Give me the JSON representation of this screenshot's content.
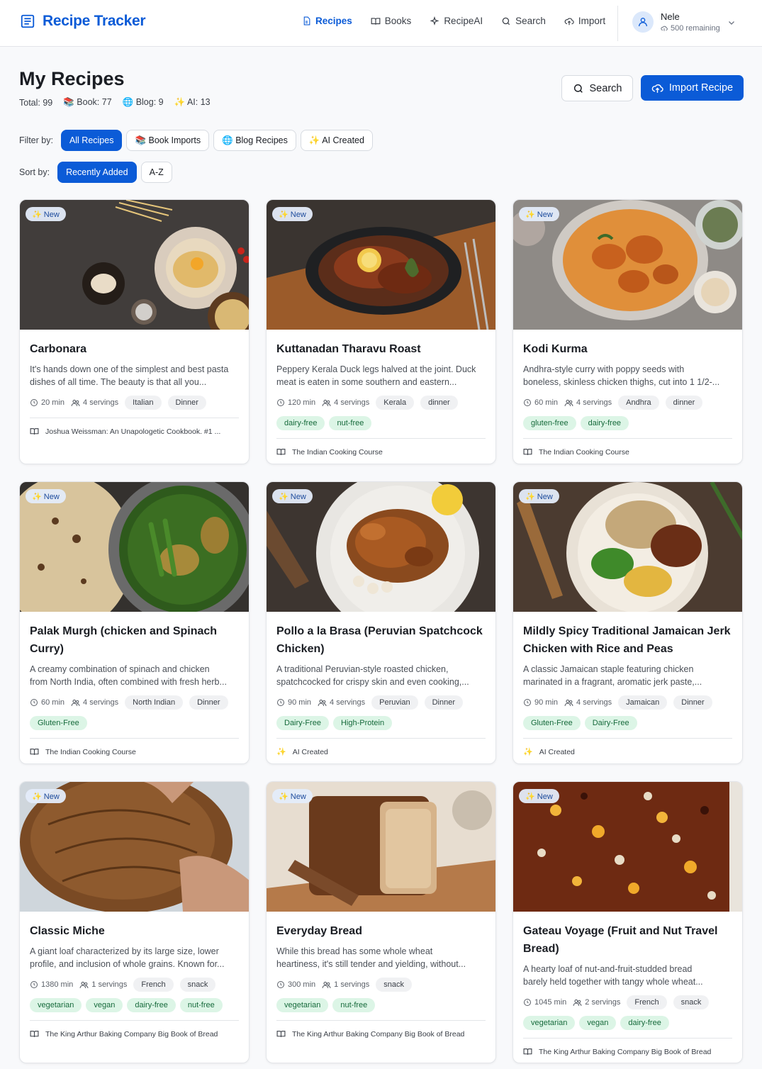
{
  "app": {
    "title": "Recipe Tracker"
  },
  "nav": [
    {
      "label": "Recipes",
      "icon": "document-icon",
      "active": true
    },
    {
      "label": "Books",
      "icon": "book-icon",
      "active": false
    },
    {
      "label": "RecipeAI",
      "icon": "sparkle-icon",
      "active": false
    },
    {
      "label": "Search",
      "icon": "search-icon",
      "active": false
    },
    {
      "label": "Import",
      "icon": "cloud-upload-icon",
      "active": false
    }
  ],
  "user": {
    "name": "Nele",
    "remaining": "500 remaining"
  },
  "page": {
    "title": "My Recipes",
    "totals": {
      "total": "Total: 99",
      "book": "📚 Book: 77",
      "blog": "🌐 Blog: 9",
      "ai": "✨ AI: 13"
    },
    "search_button": "Search",
    "import_button": "Import Recipe"
  },
  "filters": {
    "label": "Filter by:",
    "options": [
      "All Recipes",
      "📚 Book Imports",
      "🌐 Blog Recipes",
      "✨ AI Created"
    ],
    "selected": "All Recipes"
  },
  "sort": {
    "label": "Sort by:",
    "options": [
      "Recently Added",
      "A-Z"
    ],
    "selected": "Recently Added"
  },
  "badge_new": "✨ New",
  "colors": {
    "accent": "#0b5bd7",
    "tag_bg": "#dcf5e6",
    "tag_text": "#166a3b"
  },
  "recipes": [
    {
      "title": "Carbonara",
      "desc_1": "It's hands down one of the simplest and best pasta",
      "desc_2": "dishes of all time. The beauty is that all you...",
      "time": "20 min",
      "servings": "4 servings",
      "cuisine": "Italian",
      "course": "Dinner",
      "tags": [],
      "source": "Joshua Weissman: An Unapologetic Cookbook. #1 ...",
      "source_type": "book",
      "img": "pasta"
    },
    {
      "title": "Kuttanadan Tharavu Roast",
      "desc_1": "Peppery Kerala Duck legs halved at the joint. Duck",
      "desc_2": "meat is eaten in some southern and eastern...",
      "time": "120 min",
      "servings": "4 servings",
      "cuisine": "Kerala",
      "course": "dinner",
      "tags": [
        "dairy-free",
        "nut-free"
      ],
      "source": "The Indian Cooking Course",
      "source_type": "book",
      "img": "duck"
    },
    {
      "title": "Kodi Kurma",
      "desc_1": "Andhra-style curry with poppy seeds with",
      "desc_2": "boneless, skinless chicken thighs, cut into 1 1/2-...",
      "time": "60 min",
      "servings": "4 servings",
      "cuisine": "Andhra",
      "course": "dinner",
      "tags": [
        "gluten-free",
        "dairy-free"
      ],
      "source": "The Indian Cooking Course",
      "source_type": "book",
      "img": "kurma"
    },
    {
      "title": "Palak Murgh (chicken and Spinach Curry)",
      "desc_1": "A creamy combination of spinach and chicken",
      "desc_2": "from North India, often combined with fresh herb...",
      "time": "60 min",
      "servings": "4 servings",
      "cuisine": "North Indian",
      "course": "Dinner",
      "tags": [
        "Gluten-Free"
      ],
      "source": "The Indian Cooking Course",
      "source_type": "book",
      "img": "palak"
    },
    {
      "title": "Pollo a la Brasa (Peruvian Spatchcock Chicken)",
      "desc_1": "A traditional Peruvian-style roasted chicken,",
      "desc_2": "spatchcocked for crispy skin and even cooking,...",
      "time": "90 min",
      "servings": "4 servings",
      "cuisine": "Peruvian",
      "course": "Dinner",
      "tags": [
        "Dairy-Free",
        "High-Protein"
      ],
      "source": "AI Created",
      "source_type": "ai",
      "img": "pollo"
    },
    {
      "title": "Mildly Spicy Traditional Jamaican Jerk Chicken with Rice and Peas",
      "desc_1": "A classic Jamaican staple featuring chicken",
      "desc_2": "marinated in a fragrant, aromatic jerk paste,...",
      "time": "90 min",
      "servings": "4 servings",
      "cuisine": "Jamaican",
      "course": "Dinner",
      "tags": [
        "Gluten-Free",
        "Dairy-Free"
      ],
      "source": "AI Created",
      "source_type": "ai",
      "img": "jerk"
    },
    {
      "title": "Classic Miche",
      "desc_1": "A giant loaf characterized by its large size, lower",
      "desc_2": "profile, and inclusion of whole grains. Known for...",
      "time": "1380 min",
      "servings": "1 servings",
      "cuisine": "French",
      "course": "snack",
      "tags": [
        "vegetarian",
        "vegan",
        "dairy-free",
        "nut-free"
      ],
      "source": "The King Arthur Baking Company Big Book of Bread",
      "source_type": "book",
      "img": "miche"
    },
    {
      "title": "Everyday Bread",
      "desc_1": "While this bread has some whole wheat",
      "desc_2": "heartiness, it's still tender and yielding, without...",
      "time": "300 min",
      "servings": "1 servings",
      "cuisine": "",
      "course": "snack",
      "tags": [
        "vegetarian",
        "nut-free"
      ],
      "source": "The King Arthur Baking Company Big Book of Bread",
      "source_type": "book",
      "img": "bread"
    },
    {
      "title": "Gateau Voyage (Fruit and Nut Travel Bread)",
      "desc_1": "A hearty loaf of nut-and-fruit-studded bread",
      "desc_2": "barely held together with tangy whole wheat...",
      "time": "1045 min",
      "servings": "2 servings",
      "cuisine": "French",
      "course": "snack",
      "tags": [
        "vegetarian",
        "vegan",
        "dairy-free"
      ],
      "source": "The King Arthur Baking Company Big Book of Bread",
      "source_type": "book",
      "img": "gateau"
    }
  ]
}
